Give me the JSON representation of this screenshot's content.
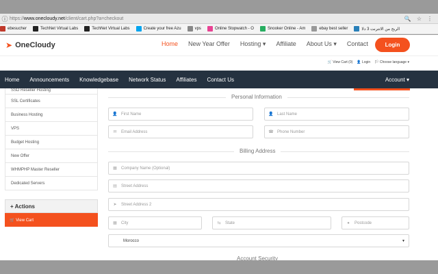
{
  "browser": {
    "url_proto": "https://",
    "url_host": "www.onecloudy.net",
    "url_path": "/client/cart.php?a=checkout",
    "bookmarks": [
      {
        "label": "ebesucher",
        "color": "#c0392b"
      },
      {
        "label": "TechNet Virtual Labs",
        "color": "#222222"
      },
      {
        "label": "TechNet Virtual Labs",
        "color": "#222222"
      },
      {
        "label": "Create your free Azu",
        "color": "#00a4ef"
      },
      {
        "label": "vps",
        "color": "#888888"
      },
      {
        "label": "Online Stopwatch - O",
        "color": "#e84393"
      },
      {
        "label": "Snooker Online - Am",
        "color": "#27ae60"
      },
      {
        "label": "ebay best seller",
        "color": "#999999"
      },
      {
        "label": "الربح من الانترنت 3 دلا",
        "color": "#2980b9"
      }
    ]
  },
  "header": {
    "brand": "OneCloudy",
    "nav": [
      "Home",
      "New Year Offer",
      "Hosting ▾",
      "Affiliate",
      "About Us ▾",
      "Contact"
    ],
    "login_label": "Login",
    "util": [
      "🛒 View Cart (0)",
      "👤 Login",
      "🏳 Choose language ▾"
    ]
  },
  "darknav": {
    "items": [
      "Home",
      "Announcements",
      "Knowledgebase",
      "Network Status",
      "Affiliates",
      "Contact Us"
    ],
    "account": "Account ▾"
  },
  "sidebar": {
    "items": [
      "SSD Reseller Hosting",
      "SSL Certificates",
      "Business Hosting",
      "VPS",
      "Budget Hosting",
      "New Offer",
      "WHMPHP Master Reseller",
      "Dedicated Servers"
    ],
    "actions_title": "+ Actions",
    "view_cart": "🛒 View Cart"
  },
  "form": {
    "personal_title": "Personal Information",
    "billing_title": "Billing Address",
    "security_title": "Account Security",
    "first_name": "First Name",
    "last_name": "Last Name",
    "email": "Email Address",
    "phone": "Phone Number",
    "company": "Company Name (Optional)",
    "street1": "Street Address",
    "street2": "Street Address 2",
    "city": "City",
    "state": "State",
    "postcode": "Postcode",
    "country": "Morocco"
  },
  "colors": {
    "accent": "#f4511e",
    "dark": "#253240"
  }
}
